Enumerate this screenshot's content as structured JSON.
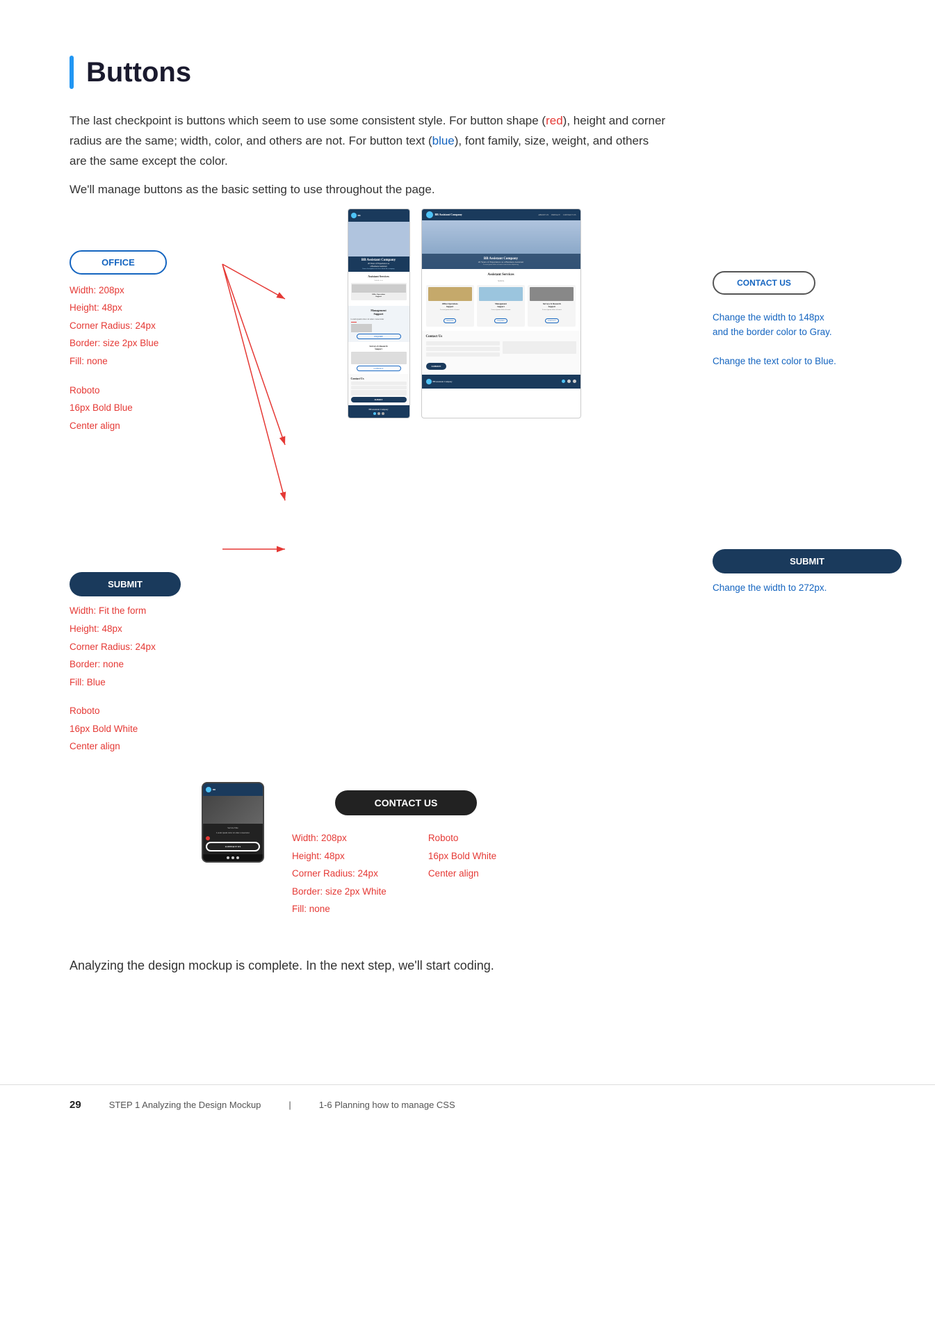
{
  "section": {
    "title": "Buttons",
    "intro": [
      "The last checkpoint is buttons which seem to use some consistent style. For button shape (",
      "red",
      "), height and corner radius are the same; width, color, and others are not. For button text (",
      "blue",
      "), font family, size, weight, and others are the same except the color.",
      "\nWe'll manage buttons as the basic setting to use throughout the page."
    ]
  },
  "left_panel": {
    "office_button": "OFFICE",
    "annotations": [
      "Width: 208px",
      "Height: 48px",
      "Corner Radius: 24px",
      "Border: size 2px Blue",
      "Fill: none"
    ],
    "font_annotations": [
      "Roboto",
      "16px Bold Blue",
      "Center align"
    ],
    "submit_button": "SUBMIT",
    "submit_annotations": [
      "Width: Fit the form",
      "Height: 48px",
      "Corner Radius: 24px",
      "Border: none",
      "Fill: Blue"
    ],
    "submit_font_annotations": [
      "Roboto",
      "16px Bold White",
      "Center align"
    ]
  },
  "right_panel": {
    "contact_us_button": "CONTACT US",
    "contact_annotation_1": "Change the width to 148px",
    "contact_annotation_2": "and the border color to Gray.",
    "contact_annotation_3": "Change the text color to Blue.",
    "submit_button": "SUBMIT",
    "submit_annotation": "Change the width to 272px."
  },
  "bottom_panel": {
    "contact_us_button": "CONTACT US",
    "annotations": [
      "Width: 208px",
      "Height: 48px",
      "Corner Radius: 24px",
      "Border: size 2px White",
      "Fill: none"
    ],
    "font_annotations": [
      "Roboto",
      "16px Bold White",
      "Center align"
    ]
  },
  "closing_text": "Analyzing the design mockup is complete. In the next step, we'll start coding.",
  "footer": {
    "page_number": "29",
    "step": "STEP 1  Analyzing the Design Mockup",
    "separator": "|",
    "topic": "1-6  Planning how to manage CSS"
  }
}
